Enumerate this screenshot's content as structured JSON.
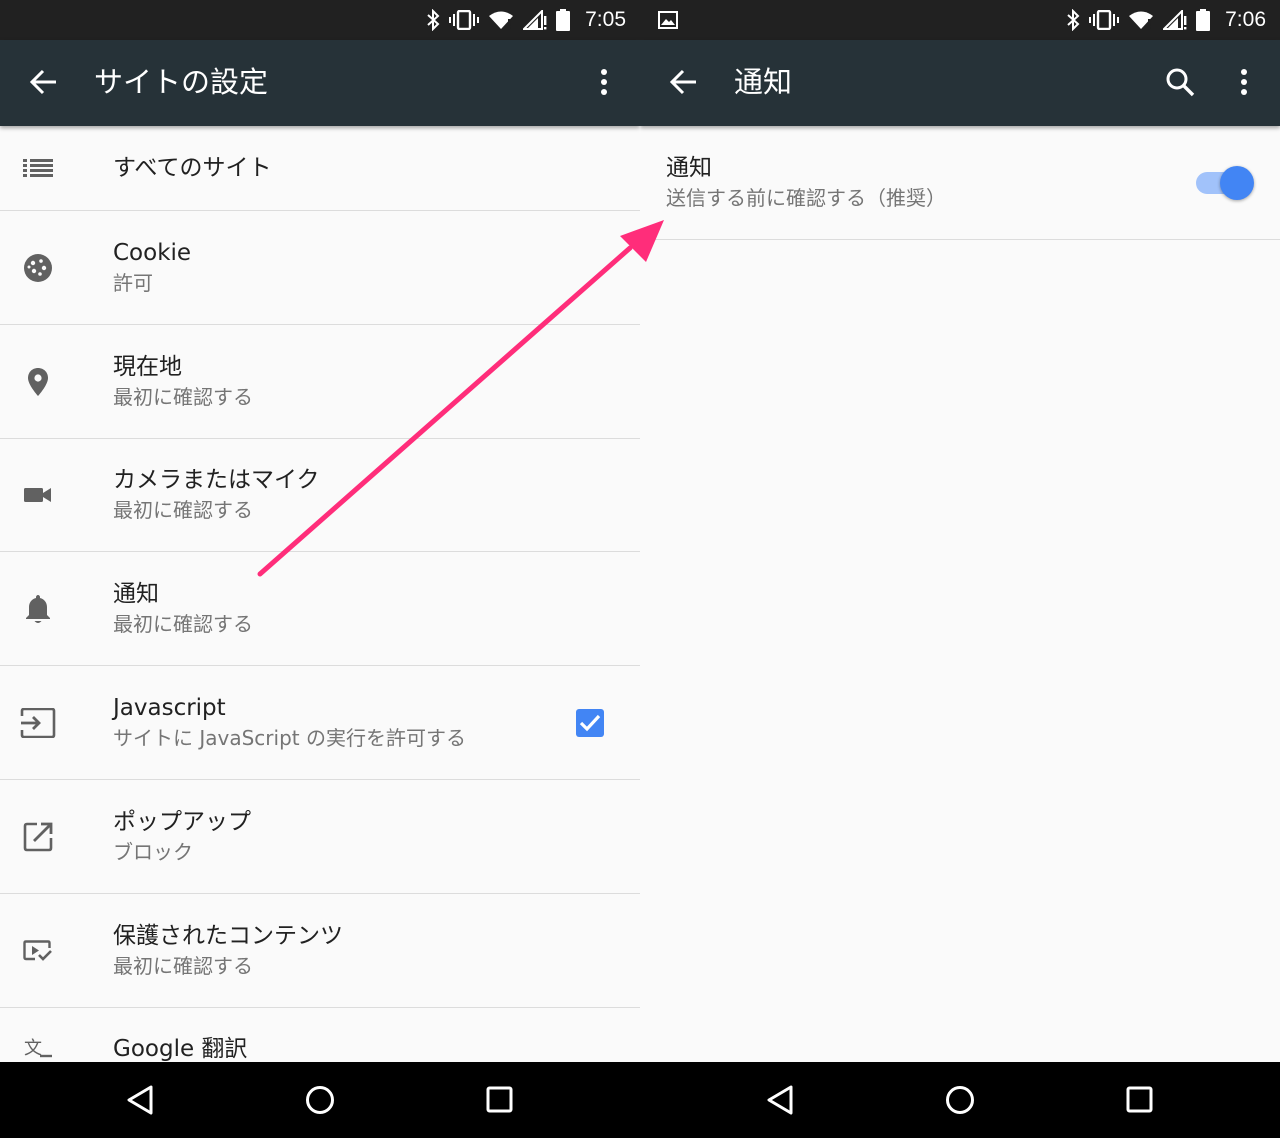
{
  "left": {
    "status": {
      "time": "7:05"
    },
    "appbar": {
      "title": "サイトの設定"
    },
    "rows": [
      {
        "icon": "list-icon",
        "primary": "すべてのサイト",
        "secondary": ""
      },
      {
        "icon": "cookie-icon",
        "primary": "Cookie",
        "secondary": "許可"
      },
      {
        "icon": "location-pin-icon",
        "primary": "現在地",
        "secondary": "最初に確認する"
      },
      {
        "icon": "videocam-icon",
        "primary": "カメラまたはマイク",
        "secondary": "最初に確認する"
      },
      {
        "icon": "bell-icon",
        "primary": "通知",
        "secondary": "最初に確認する"
      },
      {
        "icon": "input-icon",
        "primary": "Javascript",
        "secondary": "サイトに JavaScript の実行を許可する",
        "checked": true
      },
      {
        "icon": "open-in-new-icon",
        "primary": "ポップアップ",
        "secondary": "ブロック"
      },
      {
        "icon": "protected-content-icon",
        "primary": "保護されたコンテンツ",
        "secondary": "最初に確認する"
      },
      {
        "icon": "translate-icon",
        "primary": "Google 翻訳",
        "secondary": ""
      }
    ]
  },
  "right": {
    "status": {
      "time": "7:06"
    },
    "appbar": {
      "title": "通知"
    },
    "setting": {
      "primary": "通知",
      "secondary": "送信する前に確認する（推奨）",
      "enabled": true
    }
  },
  "colors": {
    "appbar": "#263238",
    "statusbar": "#212121",
    "accent": "#4285f4",
    "annotation_arrow": "#ff2d7a"
  }
}
